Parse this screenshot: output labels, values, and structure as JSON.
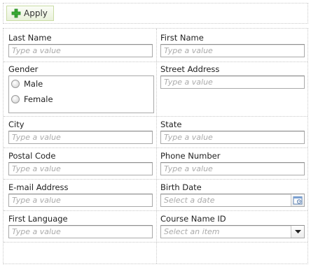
{
  "toolbar": {
    "apply_label": "Apply"
  },
  "icons": {
    "apply": "plus-icon",
    "calendar": "calendar-icon",
    "dropdown": "chevron-down-icon"
  },
  "colors": {
    "apply_icon": "#3aaa35",
    "placeholder": "#aaaaaa",
    "border": "#a9a9a9"
  },
  "form": {
    "last_name": {
      "label": "Last Name",
      "placeholder": "Type a value"
    },
    "first_name": {
      "label": "First Name",
      "placeholder": "Type a value"
    },
    "gender": {
      "label": "Gender",
      "options": [
        "Male",
        "Female"
      ]
    },
    "street_address": {
      "label": "Street Address",
      "placeholder": "Type a value"
    },
    "city": {
      "label": "City",
      "placeholder": "Type a value"
    },
    "state": {
      "label": "State",
      "placeholder": "Type a value"
    },
    "postal_code": {
      "label": "Postal Code",
      "placeholder": "Type a value"
    },
    "phone_number": {
      "label": "Phone Number",
      "placeholder": "Type a value"
    },
    "email": {
      "label": "E-mail Address",
      "placeholder": "Type a value"
    },
    "birth_date": {
      "label": "Birth Date",
      "placeholder": "Select a date"
    },
    "first_language": {
      "label": "First Language",
      "placeholder": "Type a value"
    },
    "course_name_id": {
      "label": "Course Name ID",
      "placeholder": "Select an item"
    }
  }
}
